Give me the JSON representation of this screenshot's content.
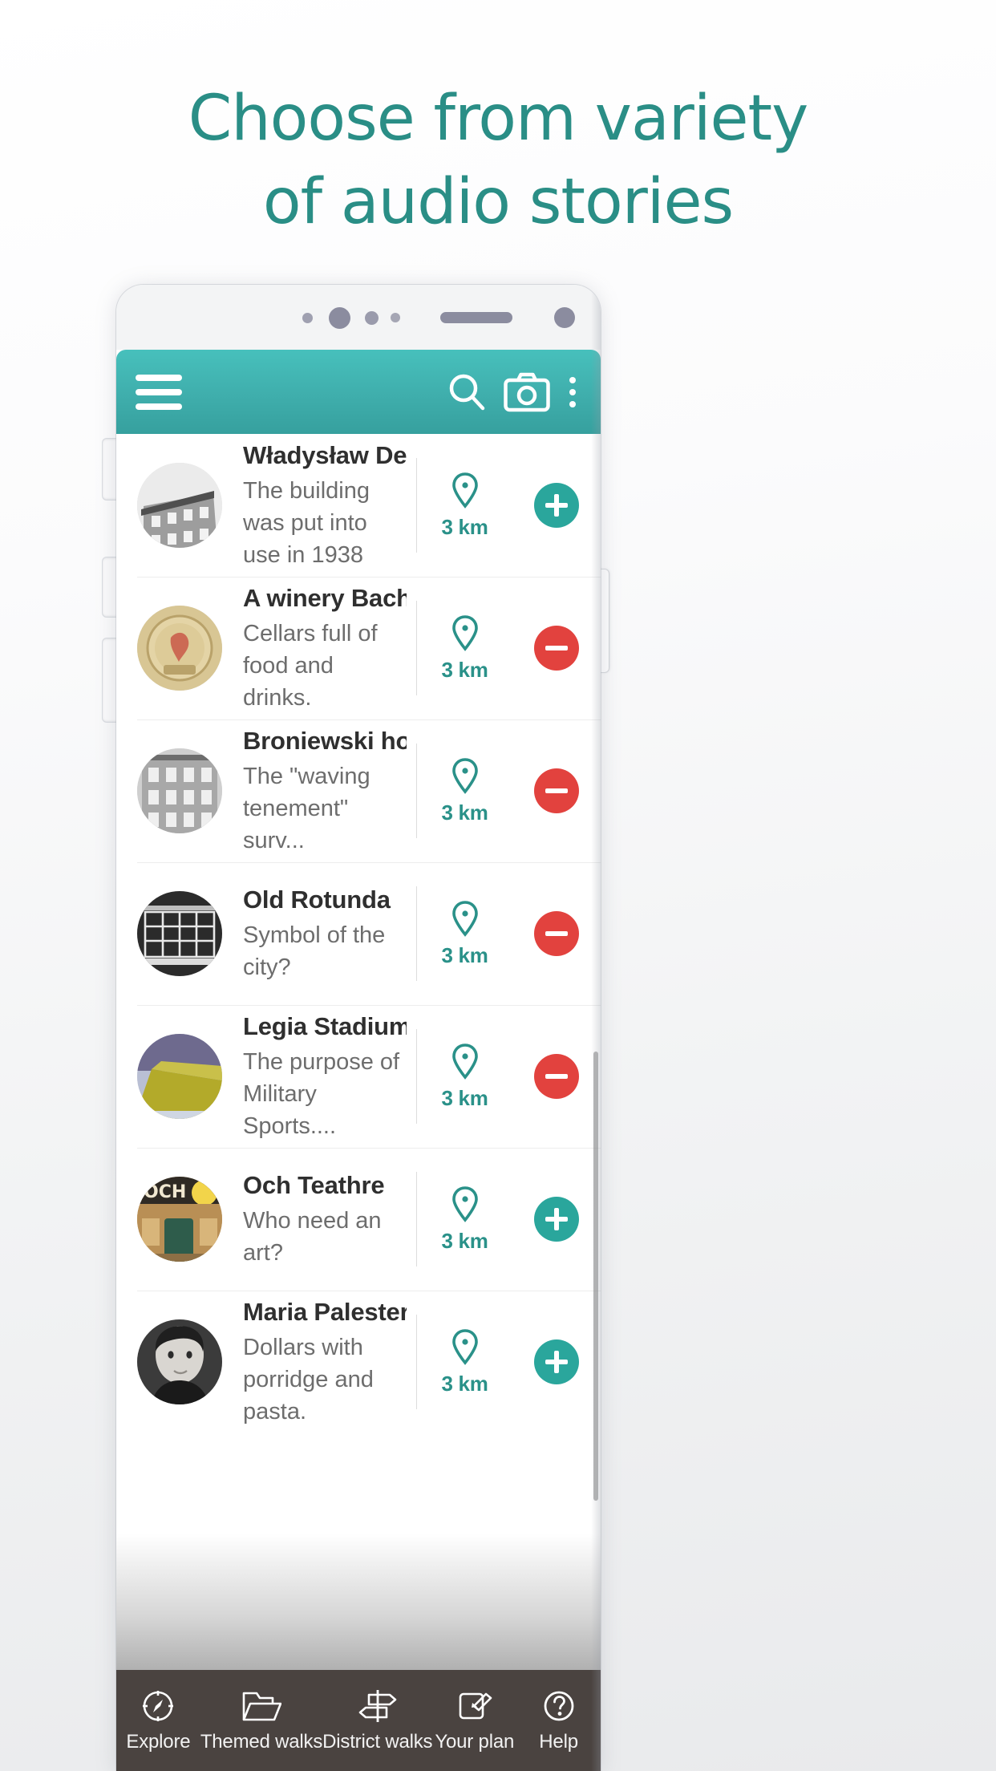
{
  "headline": {
    "line1": "Choose from variety",
    "line2": "of audio stories"
  },
  "colors": {
    "teal_accent": "#2a9189",
    "appbar_top": "#47c0bc",
    "appbar_bottom": "#36a09e",
    "add_badge": "#2aa69c",
    "remove_badge": "#e2423e",
    "bottom_nav_bg": "#4a4340"
  },
  "appbar": {
    "menu_icon": "hamburger-menu-icon",
    "search_icon": "search-icon",
    "camera_icon": "camera-icon",
    "overflow_icon": "kebab-menu-icon"
  },
  "list": {
    "items": [
      {
        "title": "Władysław Demba...",
        "subtitle": "The building was put into use in 1938",
        "distance": "3 km",
        "pin_icon": "map-pin-icon",
        "action": "add",
        "action_icon": "plus-circle-icon",
        "thumb": "bw-building-photo"
      },
      {
        "title": "A winery Bachus",
        "subtitle": "Cellars full of food and drinks.",
        "distance": "3 km",
        "pin_icon": "map-pin-icon",
        "action": "remove",
        "action_icon": "minus-circle-icon",
        "thumb": "winery-emblem-photo"
      },
      {
        "title": "Broniewski house",
        "subtitle": "The \"waving tenement\" surv...",
        "distance": "3 km",
        "pin_icon": "map-pin-icon",
        "action": "remove",
        "action_icon": "minus-circle-icon",
        "thumb": "bw-tenement-photo"
      },
      {
        "title": "Old Rotunda",
        "subtitle": "Symbol of the city?",
        "distance": "3 km",
        "pin_icon": "map-pin-icon",
        "action": "remove",
        "action_icon": "minus-circle-icon",
        "thumb": "bw-rotunda-photo"
      },
      {
        "title": "Legia Stadium",
        "subtitle": "The purpose of Military Sports....",
        "distance": "3 km",
        "pin_icon": "map-pin-icon",
        "action": "remove",
        "action_icon": "minus-circle-icon",
        "thumb": "stadium-flag-photo"
      },
      {
        "title": "Och Teathre",
        "subtitle": "Who need an art?",
        "distance": "3 km",
        "pin_icon": "map-pin-icon",
        "action": "add",
        "action_icon": "plus-circle-icon",
        "thumb": "theatre-facade-photo"
      },
      {
        "title": "Maria Palester house",
        "subtitle": "Dollars with porridge and pasta.",
        "distance": "3 km",
        "pin_icon": "map-pin-icon",
        "action": "add",
        "action_icon": "plus-circle-icon",
        "thumb": "bw-portrait-photo"
      }
    ]
  },
  "bottom_nav": {
    "items": [
      {
        "label": "Explore",
        "icon": "compass-icon"
      },
      {
        "label": "Themed walks",
        "icon": "folder-icon"
      },
      {
        "label": "District walks",
        "icon": "signpost-icon"
      },
      {
        "label": "Your plan",
        "icon": "edit-square-icon"
      },
      {
        "label": "Help",
        "icon": "question-circle-icon"
      }
    ]
  }
}
